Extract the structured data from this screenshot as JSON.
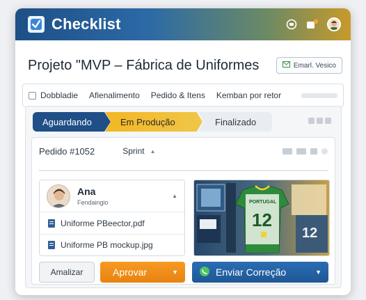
{
  "app": {
    "title": "Checklist"
  },
  "header": {
    "project_title": "Projeto \"MVP – Fábrica de Uniformes",
    "email_button": "Emarl. Vesico"
  },
  "menu": {
    "items": [
      {
        "label": "Dobbladie"
      },
      {
        "label": "Afienalimento"
      },
      {
        "label": "Pedido & Itens"
      },
      {
        "label": "Kemban por retor"
      }
    ]
  },
  "stages": [
    {
      "label": "Aguardando",
      "state": "done"
    },
    {
      "label": "Em Produção",
      "state": "active"
    },
    {
      "label": "Finalizado",
      "state": "pending"
    }
  ],
  "card": {
    "order": "Pedido #1052",
    "sprint": "Sprint",
    "person": {
      "name": "Ana",
      "role": "Fendaingio"
    },
    "files": [
      {
        "name": "Uniforme PBeector,pdf"
      },
      {
        "name": "Uniforme PB mockup.jpg"
      }
    ],
    "preview": {
      "jersey_text": "PORTUGAL",
      "jersey_number": "12",
      "poster_number": "12"
    }
  },
  "actions": {
    "secondary": "Amalizar",
    "approve": "Aprovar",
    "fix": "Enviar Correção"
  },
  "colors": {
    "primary": "#1f4f86",
    "accent": "#f3b722",
    "approve": "#ef8f1a",
    "fix": "#2466aa"
  },
  "icons": [
    "checklist-logo-icon",
    "chat-icon",
    "notification-icon",
    "user-avatar",
    "mail-icon",
    "file-icon",
    "chevron-down-icon",
    "whatsapp-icon"
  ]
}
